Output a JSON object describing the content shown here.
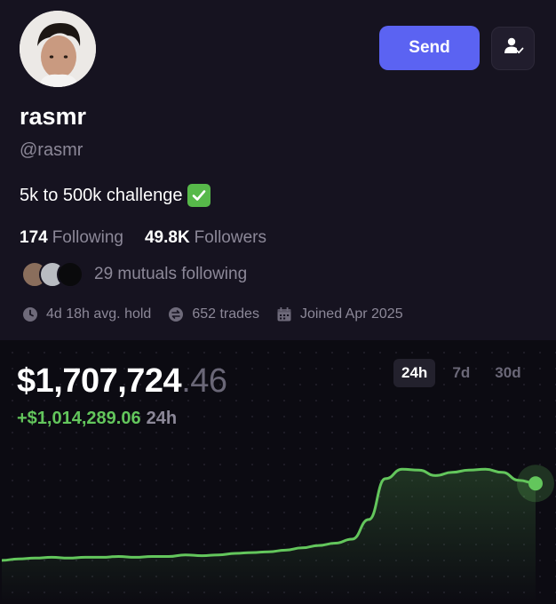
{
  "profile": {
    "display_name": "rasmr",
    "handle": "@rasmr",
    "bio": "5k to 500k challenge",
    "bio_emoji": "check-mark-emoji",
    "send_label": "Send",
    "following_count": "174",
    "following_label": "Following",
    "followers_count": "49.8K",
    "followers_label": "Followers",
    "mutuals_text": "29 mutuals following",
    "avg_hold": "4d 18h avg. hold",
    "trades": "652 trades",
    "joined": "Joined Apr 2025"
  },
  "portfolio": {
    "balance_main": "$1,707,724",
    "balance_cents": ".46",
    "change_value": "+$1,014,289.06",
    "change_period": "24h",
    "ranges": [
      "24h",
      "7d",
      "30d"
    ],
    "active_range": "24h"
  },
  "colors": {
    "background": "#161320",
    "send_button": "#5b63f2",
    "positive": "#63c65c",
    "muted_text": "#8c8898"
  },
  "chart_data": {
    "type": "line",
    "series": [
      {
        "values": [
          0.58,
          0.6,
          0.61,
          0.62,
          0.61,
          0.62,
          0.62,
          0.63,
          0.62,
          0.63,
          0.63,
          0.65,
          0.64,
          0.65,
          0.67,
          0.68,
          0.69,
          0.71,
          0.74,
          0.77,
          0.8,
          0.85,
          1.1,
          1.62,
          1.74,
          1.73,
          1.66,
          1.7,
          1.73,
          1.74,
          1.7,
          1.6,
          1.56
        ]
      }
    ]
  }
}
